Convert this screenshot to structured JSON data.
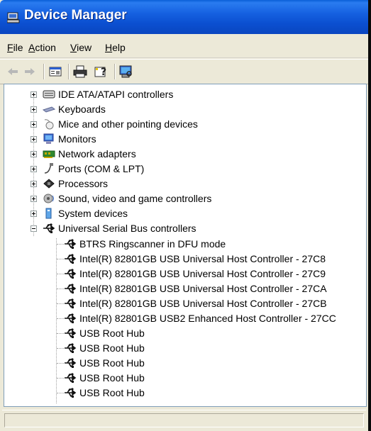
{
  "window": {
    "title": "Device Manager"
  },
  "menu": [
    {
      "key": "F",
      "rest": "ile"
    },
    {
      "key": "A",
      "rest": "ction"
    },
    {
      "key": "V",
      "rest": "iew"
    },
    {
      "key": "H",
      "rest": "elp"
    }
  ],
  "toolbar": {
    "buttons": [
      "back-icon",
      "forward-icon",
      "properties-icon",
      "print-icon",
      "help-icon",
      "scan-hardware-icon"
    ]
  },
  "tree": {
    "categories": [
      {
        "label": "IDE ATA/ATAPI controllers",
        "icon": "ide-controller-icon",
        "expanded": false
      },
      {
        "label": "Keyboards",
        "icon": "keyboard-icon",
        "expanded": false
      },
      {
        "label": "Mice and other pointing devices",
        "icon": "mouse-icon",
        "expanded": false
      },
      {
        "label": "Monitors",
        "icon": "monitor-icon",
        "expanded": false
      },
      {
        "label": "Network adapters",
        "icon": "network-adapter-icon",
        "expanded": false
      },
      {
        "label": "Ports (COM & LPT)",
        "icon": "port-icon",
        "expanded": false
      },
      {
        "label": "Processors",
        "icon": "processor-icon",
        "expanded": false
      },
      {
        "label": "Sound, video and game controllers",
        "icon": "sound-icon",
        "expanded": false
      },
      {
        "label": "System devices",
        "icon": "system-device-icon",
        "expanded": false
      },
      {
        "label": "Universal Serial Bus controllers",
        "icon": "usb-icon",
        "expanded": true
      }
    ],
    "usb_children": [
      "BTRS Ringscanner in DFU mode",
      "Intel(R) 82801GB USB Universal Host Controller - 27C8",
      "Intel(R) 82801GB USB Universal Host Controller - 27C9",
      "Intel(R) 82801GB USB Universal Host Controller - 27CA",
      "Intel(R) 82801GB USB Universal Host Controller - 27CB",
      "Intel(R) 82801GB USB2 Enhanced Host Controller - 27CC",
      "USB Root Hub",
      "USB Root Hub",
      "USB Root Hub",
      "USB Root Hub",
      "USB Root Hub"
    ]
  },
  "statusbar": {
    "text": ""
  }
}
